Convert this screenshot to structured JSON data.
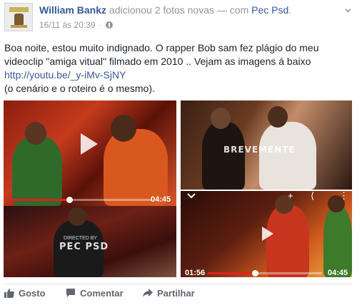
{
  "post": {
    "author": "William Bankz",
    "action_text": "adicionou 2 fotos novas — com",
    "tagged": "Pec Psd",
    "timestamp": "16/11 às 20:39 ·",
    "avatar_text": "LIL BANKZ",
    "body_line1": "Boa noite, estou muito indignado. O rapper Bob sam fez plágio do meu videoclip \"amiga vitual\" filmado em 2010 .. Vejam as imagens á baixo",
    "link": "http://youtu.be/_y-iMv-SjNY",
    "body_line3": "(o cenário e o roteiro é o mesmo)."
  },
  "photos": {
    "p1": {
      "duration": "04:45",
      "progress": 0.42
    },
    "p2": {
      "watermark": "BREVEMENTE"
    },
    "p3": {
      "watermark_small": "DIRECTED BY",
      "watermark": "PEC PSD"
    },
    "p4": {
      "current": "01:56",
      "duration": "04:45",
      "progress": 0.41
    }
  },
  "actions": {
    "like": "Gosto",
    "comment": "Comentar",
    "share": "Partilhar"
  },
  "colors": {
    "link": "#365899",
    "meta": "#90949c",
    "action": "#606770",
    "progress": "#e02020"
  }
}
